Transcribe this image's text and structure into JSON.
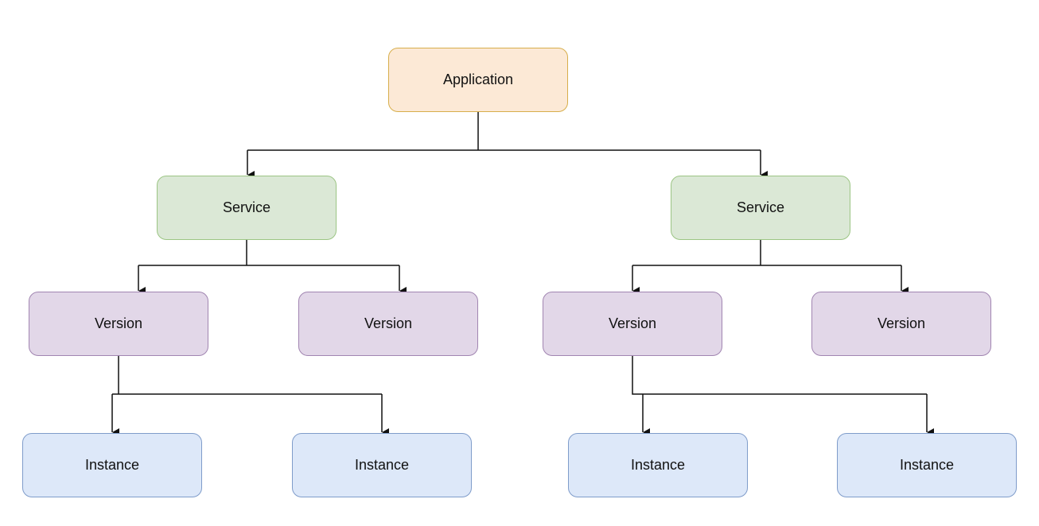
{
  "diagram": {
    "application": {
      "label": "Application"
    },
    "services": [
      {
        "label": "Service"
      },
      {
        "label": "Service"
      }
    ],
    "versions": [
      {
        "label": "Version"
      },
      {
        "label": "Version"
      },
      {
        "label": "Version"
      },
      {
        "label": "Version"
      }
    ],
    "instances": [
      {
        "label": "Instance"
      },
      {
        "label": "Instance"
      },
      {
        "label": "Instance"
      },
      {
        "label": "Instance"
      }
    ]
  },
  "colors": {
    "application_fill": "#fce9d6",
    "application_border": "#d7ae4b",
    "service_fill": "#dbe8d6",
    "service_border": "#9cc584",
    "version_fill": "#e2d7e8",
    "version_border": "#a185b1",
    "instance_fill": "#dde8f9",
    "instance_border": "#7f9cca",
    "connector": "#111111"
  }
}
